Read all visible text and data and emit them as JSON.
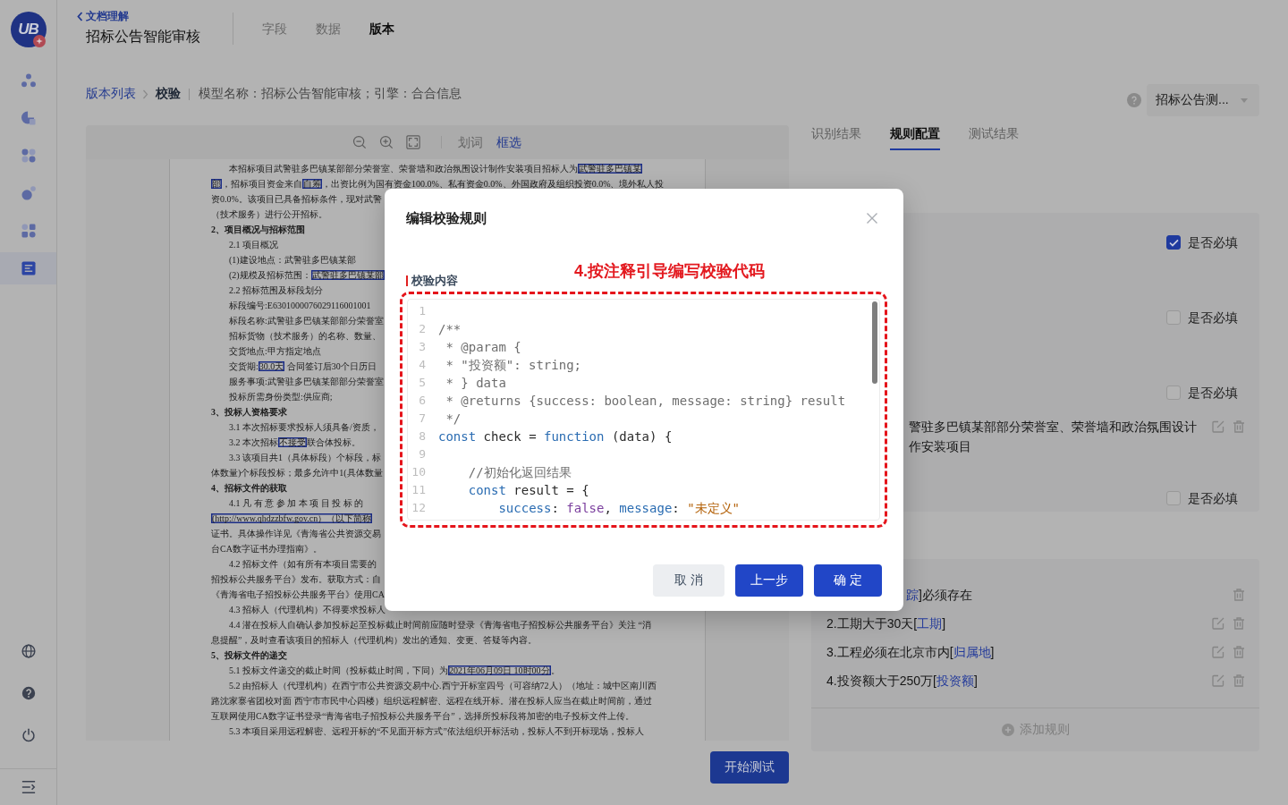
{
  "sidebar": {
    "logo": "UB",
    "nav_items": [
      {
        "selected": false
      },
      {
        "selected": false
      },
      {
        "selected": false
      },
      {
        "selected": false
      },
      {
        "selected": false
      },
      {
        "selected": true
      }
    ]
  },
  "header": {
    "back_link": "文档理解",
    "title": "招标公告智能审核",
    "tabs": [
      {
        "label": "字段",
        "selected": false
      },
      {
        "label": "数据",
        "selected": false
      },
      {
        "label": "版本",
        "selected": true
      }
    ]
  },
  "breadcrumb": {
    "items": [
      {
        "label": "版本列表",
        "kind": "link"
      },
      {
        "label": "校验",
        "kind": "current"
      }
    ],
    "info": "模型名称：招标公告智能审核；引擎：合合信息"
  },
  "document_viewer": {
    "modes": [
      {
        "label": "划词",
        "selected": false
      },
      {
        "label": "框选",
        "selected": true
      }
    ],
    "lines": [
      {
        "kind": "indent",
        "segments": [
          {
            "kind": "plain",
            "text": "本招标项目武警驻多巴镇某部部分荣誉室、荣誉墙和政治氛围设计制作安装项目招标人为"
          },
          {
            "kind": "boxed",
            "text": "武警驻多巴镇某"
          }
        ]
      },
      {
        "kind": "flush",
        "segments": [
          {
            "kind": "boxed",
            "text": "部"
          },
          {
            "kind": "plain",
            "text": "，招标项目资金来自"
          },
          {
            "kind": "boxed",
            "text": "自筹"
          },
          {
            "kind": "plain",
            "text": "，出资比例为国有资金100.0%、私有资金0.0%、外国政府及组织投资0.0%、境外私人投"
          }
        ]
      },
      {
        "kind": "flush",
        "text": "资0.0%。该项目已具备招标条件，现对武警"
      },
      {
        "kind": "flush",
        "text": "（技术服务）进行公开招标。"
      },
      {
        "kind": "heading",
        "text": "2、项目概况与招标范围"
      },
      {
        "kind": "indent",
        "text": "2.1 项目概况"
      },
      {
        "kind": "indent",
        "text": "(1)建设地点：武警驻多巴镇某部"
      },
      {
        "kind": "indent",
        "segments": [
          {
            "kind": "plain",
            "text": "(2)规模及招标范围："
          },
          {
            "kind": "boxed",
            "text": "武警驻多巴镇某部"
          }
        ]
      },
      {
        "kind": "indent",
        "text": "2.2 招标范围及标段划分"
      },
      {
        "kind": "indent",
        "text": "标段编号:E6301000076029116001001"
      },
      {
        "kind": "indent",
        "text": "标段名称:武警驻多巴镇某部部分荣誉室"
      },
      {
        "kind": "indent",
        "text": "招标货物（技术服务）的名称、数量、"
      },
      {
        "kind": "indent",
        "text": "交货地点:甲方指定地点"
      },
      {
        "kind": "indent",
        "segments": [
          {
            "kind": "plain",
            "text": "交货期:"
          },
          {
            "kind": "boxed",
            "text": "30.0天"
          },
          {
            "kind": "plain",
            "text": " 合同签订后30个日历日"
          }
        ]
      },
      {
        "kind": "indent",
        "text": "服务事项:武警驻多巴镇某部部分荣誉室"
      },
      {
        "kind": "indent",
        "text": "投标所需身份类型:供应商;"
      },
      {
        "kind": "heading",
        "text": "3、投标人资格要求"
      },
      {
        "kind": "indent",
        "text": "3.1 本次招标要求投标人须具备/资质，"
      },
      {
        "kind": "indent",
        "segments": [
          {
            "kind": "plain",
            "text": "3.2 本次招标"
          },
          {
            "kind": "boxed",
            "text": "不接受"
          },
          {
            "kind": "plain",
            "text": "联合体投标。"
          }
        ]
      },
      {
        "kind": "indent",
        "text": "3.3 该项目共1（具体标段）个标段，标"
      },
      {
        "kind": "flush",
        "text": "体数量)个标段投标；最多允许中1(具体数量"
      },
      {
        "kind": "heading",
        "text": "4、招标文件的获取"
      },
      {
        "kind": "indent",
        "text": "4.1 凡 有 意 参 加 本 项 目 投 标 的"
      },
      {
        "kind": "flush",
        "segments": [
          {
            "kind": "boxed",
            "text": "(http://www.qhdzzbfw.gov.cn）（以下简称"
          }
        ]
      },
      {
        "kind": "flush",
        "text": "证书。具体操作详见《青海省公共资源交易"
      },
      {
        "kind": "flush",
        "text": "台CA数字证书办理指南》。"
      },
      {
        "kind": "indent",
        "text": "4.2 招标文件（如有所有本项目需要的"
      },
      {
        "kind": "flush",
        "text": "招投标公共服务平台》发布。获取方式：自"
      },
      {
        "kind": "flush",
        "text": "《青海省电子招投标公共服务平台》使用CA"
      },
      {
        "kind": "indent",
        "text": "4.3 招标人（代理机构）不得要求投标人"
      },
      {
        "kind": "indent",
        "text": "4.4 潜在投标人自确认参加投标起至投标截止时间前应随时登录《青海省电子招投标公共服务平台》关注 “消"
      },
      {
        "kind": "flush",
        "text": "息提醒”，及时查看该项目的招标人（代理机构）发出的通知、变更、答疑等内容。"
      },
      {
        "kind": "heading",
        "text": "5、投标文件的递交"
      },
      {
        "kind": "indent",
        "segments": [
          {
            "kind": "plain",
            "text": "5.1 投标文件递交的截止时间（投标截止时间，下同）为"
          },
          {
            "kind": "boxed",
            "text": "2021年06月09日 10时00分"
          },
          {
            "kind": "plain",
            "text": "。"
          }
        ]
      },
      {
        "kind": "indent",
        "text": "5.2 由招标人（代理机构）在西宁市公共资源交易中心.西宁开标室四号（可容纳72人）（地址：城中区南川西"
      },
      {
        "kind": "flush",
        "text": "路沈家寨省团校对面 西宁市市民中心四楼）组织远程解密、远程在线开标。潜在投标人应当在截止时间前，通过"
      },
      {
        "kind": "flush",
        "text": "互联网使用CA数字证书登录“青海省电子招投标公共服务平台”，选择所投标段将加密的电子投标文件上传。"
      },
      {
        "kind": "indent",
        "text": "5.3 本项目采用远程解密、远程开标的“不见面开标方式”依法组织开标活动，投标人不到开标现场，投标人"
      }
    ]
  },
  "start_test_button": "开始测试",
  "right_panel": {
    "template_select": "招标公告测...",
    "tabs": [
      {
        "label": "识别结果",
        "selected": false
      },
      {
        "label": "规则配置",
        "selected": true
      },
      {
        "label": "测试结果",
        "selected": false
      }
    ],
    "fields": [
      {
        "required_label": "是否必填",
        "required": true
      },
      {
        "required_label": "是否必填",
        "required": false
      },
      {
        "required_label": "是否必填",
        "required": false,
        "value_lines": [
          "警驻多巴镇某部部分荣誉室、荣誉墙和政治氛围设计",
          "作安装项目"
        ],
        "actions": [
          {
            "kind": "edit"
          },
          {
            "kind": "delete"
          }
        ]
      },
      {
        "required_label": "是否必填",
        "required": false
      }
    ],
    "rules": [
      {
        "field": "踪",
        "suffix": "]必须存在",
        "actions": [
          {
            "kind": "delete"
          }
        ]
      },
      {
        "prefix": "2.工期大于30天[",
        "field": "工期",
        "suffix": "]",
        "actions": [
          {
            "kind": "edit"
          },
          {
            "kind": "delete"
          }
        ]
      },
      {
        "prefix": "3.工程必须在北京市内[",
        "field": "归属地",
        "suffix": "]",
        "actions": [
          {
            "kind": "edit"
          },
          {
            "kind": "delete"
          }
        ]
      },
      {
        "prefix": "4.投资额大于250万[",
        "field": "投资额",
        "suffix": "]",
        "actions": [
          {
            "kind": "edit"
          },
          {
            "kind": "delete"
          }
        ]
      }
    ],
    "add_rule": "添加规则"
  },
  "dialog": {
    "title": "编辑校验规则",
    "annotation": "4.按注释引导编写校验代码",
    "field_label": "校验内容",
    "code_lines": [
      {
        "number": "1"
      },
      {
        "number": "2",
        "tokens": [
          {
            "kind": "comment",
            "text": "/**"
          }
        ]
      },
      {
        "number": "3",
        "tokens": [
          {
            "kind": "comment",
            "text": " * @param {"
          }
        ]
      },
      {
        "number": "4",
        "tokens": [
          {
            "kind": "comment",
            "text": " * \"投资额\": string;"
          }
        ]
      },
      {
        "number": "5",
        "tokens": [
          {
            "kind": "comment",
            "text": " * } data"
          }
        ]
      },
      {
        "number": "6",
        "tokens": [
          {
            "kind": "comment",
            "text": " * @returns {success: boolean, message: string} result"
          }
        ]
      },
      {
        "number": "7",
        "tokens": [
          {
            "kind": "comment",
            "text": " */"
          }
        ]
      },
      {
        "number": "8",
        "tokens": [
          {
            "kind": "keyword",
            "text": "const"
          },
          {
            "kind": "plain",
            "text": " check = "
          },
          {
            "kind": "keyword",
            "text": "function"
          },
          {
            "kind": "plain",
            "text": " (data) {"
          }
        ]
      },
      {
        "number": "9"
      },
      {
        "number": "10",
        "tokens": [
          {
            "kind": "comment",
            "text": "    //初始化返回结果"
          }
        ]
      },
      {
        "number": "11",
        "tokens": [
          {
            "kind": "keyword",
            "text": "    const"
          },
          {
            "kind": "plain",
            "text": " result = {"
          }
        ]
      },
      {
        "number": "12",
        "tokens": [
          {
            "kind": "property",
            "text": "        success"
          },
          {
            "kind": "plain",
            "text": ": "
          },
          {
            "kind": "literal",
            "text": "false"
          },
          {
            "kind": "plain",
            "text": ", "
          },
          {
            "kind": "property",
            "text": "message"
          },
          {
            "kind": "plain",
            "text": ": "
          },
          {
            "kind": "string",
            "text": "\"未定义\""
          }
        ]
      }
    ],
    "buttons": [
      {
        "label": "取 消",
        "kind": "secondary"
      },
      {
        "label": "上一步",
        "kind": "primary"
      },
      {
        "label": "确 定",
        "kind": "primary"
      }
    ]
  }
}
